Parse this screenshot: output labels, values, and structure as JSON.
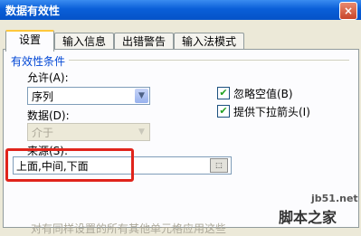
{
  "window": {
    "title": "数据有效性",
    "close_label": "×"
  },
  "tabs": [
    {
      "label": "设置",
      "active": true
    },
    {
      "label": "输入信息"
    },
    {
      "label": "出错警告"
    },
    {
      "label": "输入法模式"
    }
  ],
  "group": {
    "title": "有效性条件"
  },
  "allow": {
    "label": "允许(A):",
    "value": "序列"
  },
  "data": {
    "label": "数据(D):",
    "value": "介于"
  },
  "options": {
    "ignore_blank": {
      "label": "忽略空值(B)",
      "checked": true
    },
    "dropdown": {
      "label": "提供下拉箭头(I)",
      "checked": true
    }
  },
  "source": {
    "label": "来源(S):",
    "value": "上面,中间,下面"
  },
  "apply_all": {
    "label": "对有同样设置的所有其他单元格应用这些"
  },
  "watermark": {
    "site": "jb51.net",
    "name": "脚本之家"
  },
  "colors": {
    "title_bar": "#0a5fd8",
    "highlight": "#e0241b",
    "dialog_bg": "#ece9d8"
  }
}
